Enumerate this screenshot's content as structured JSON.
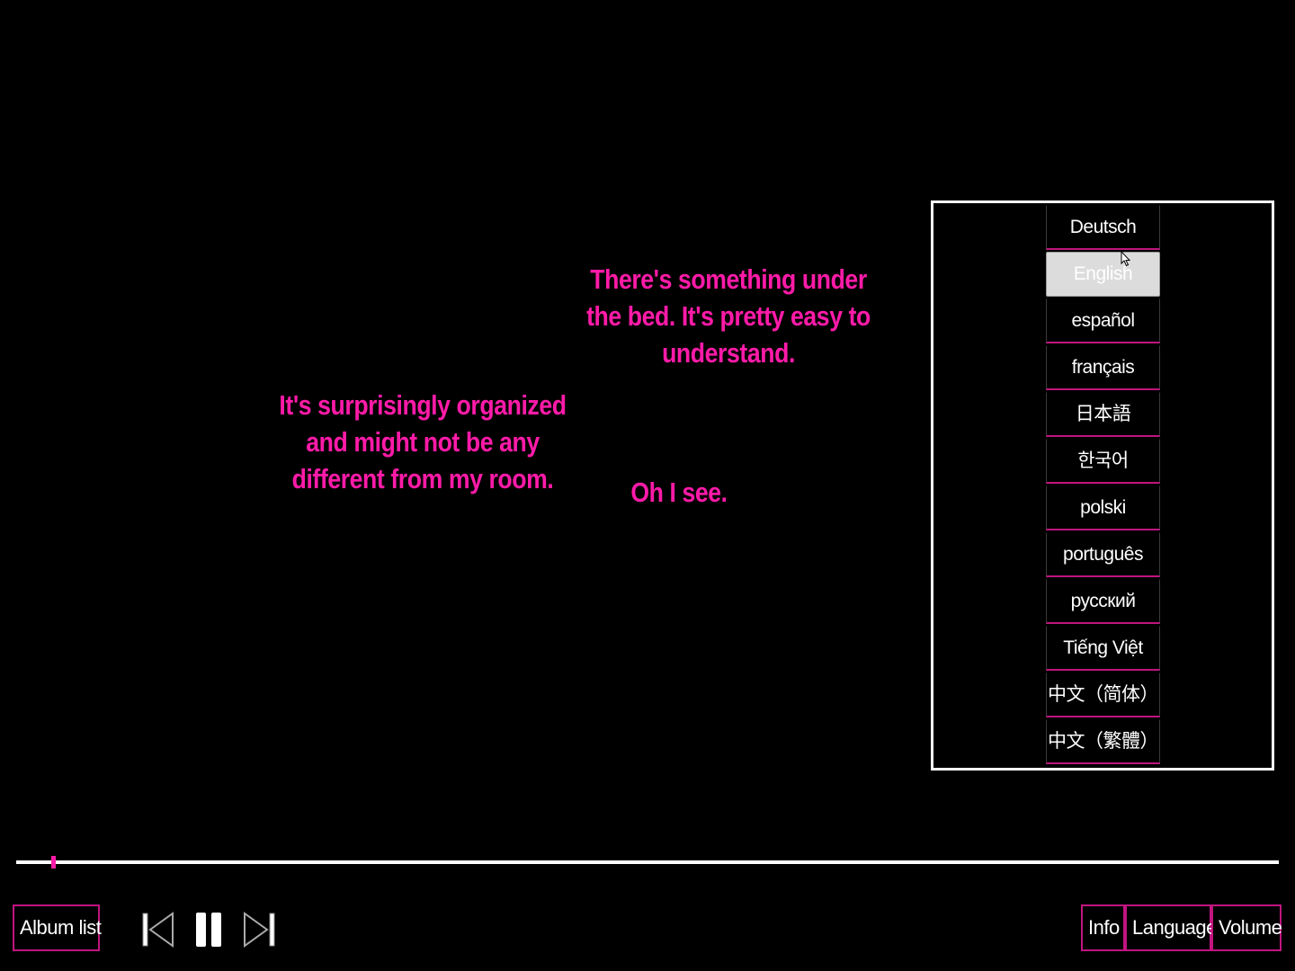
{
  "captions": {
    "line1": "There's something under the bed. It's pretty easy to understand.",
    "line2": "It's surprisingly organized and might not be any different from my room.",
    "line3": "Oh I see."
  },
  "languages": [
    {
      "label": "Deutsch"
    },
    {
      "label": "English",
      "selected": true
    },
    {
      "label": "español"
    },
    {
      "label": "français"
    },
    {
      "label": "日本語"
    },
    {
      "label": "한국어"
    },
    {
      "label": "polski"
    },
    {
      "label": "português"
    },
    {
      "label": "русский"
    },
    {
      "label": "Tiếng Việt"
    },
    {
      "label": "中文（简体）"
    },
    {
      "label": "中文（繁體）"
    }
  ],
  "player": {
    "progress": 0.028,
    "album_list_label": "Album list",
    "info_label": "Info",
    "language_label": "Language",
    "volume_label": "Volume",
    "prev_icon": "skip-previous-icon",
    "pause_icon": "pause-icon",
    "next_icon": "skip-next-icon"
  },
  "colors": {
    "accent": "#ff1ba8",
    "border": "#c0157f",
    "background": "#000000",
    "selected": "#dcdcdc"
  }
}
